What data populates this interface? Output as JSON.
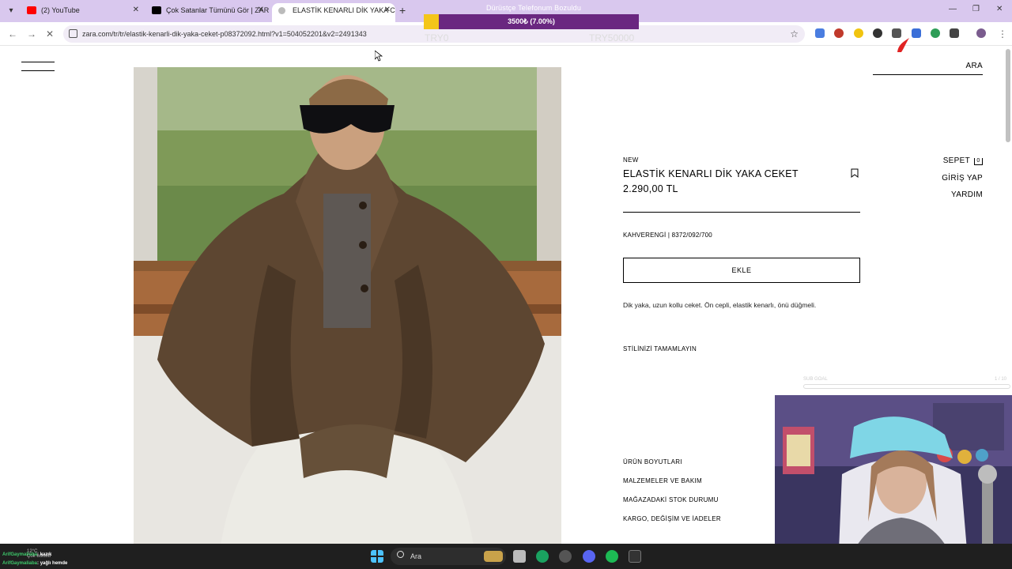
{
  "browser": {
    "tabs": [
      {
        "label": "(2) YouTube",
        "favicon_color": "#ff0000",
        "active": false
      },
      {
        "label": "Çok Satanlar Tümünü Gör | ZAR",
        "favicon_color": "#000000",
        "active": false
      },
      {
        "label": "ELASTİK KENARLI DİK YAKA CEK",
        "favicon_color": "#888888",
        "active": true
      }
    ],
    "new_tab_glyph": "+",
    "url": "zara.com/tr/tr/elastik-kenarli-dik-yaka-ceket-p08372092.html?v1=504052201&v2=2491343"
  },
  "donation_overlay": {
    "title": "Dürüstçe Telefonum Bozuldu",
    "progress_text": "3500₺ (7.00%)",
    "progress_fraction": 0.07,
    "min_label": "TRY0",
    "max_label": "TRY50000"
  },
  "zara": {
    "header": {
      "search_label": "ARA",
      "cart_label": "SEPET",
      "cart_count": "0",
      "login_label": "GİRİŞ YAP",
      "help_label": "YARDIM"
    },
    "product": {
      "badge": "NEW",
      "title": "ELASTİK KENARLI DİK YAKA CEKET",
      "price": "2.290,00 TL",
      "color_ref": "KAHVERENGİ | 8372/092/700",
      "add_button": "EKLE",
      "description": "Dik yaka, uzun kollu ceket. Ön cepli, elastik kenarlı, önü düğmeli.",
      "style_heading": "STİLİNİZİ TAMAMLAYIN",
      "links": [
        "ÜRÜN BOYUTLARI",
        "MALZEMELER VE BAKIM",
        "MAĞAZADAKİ STOK DURUMU",
        "KARGO, DEĞİŞİM VE İADELER"
      ]
    }
  },
  "stream_overlay": {
    "goal_label": "SUB GOAL",
    "goal_count": "1 / 10",
    "chat": [
      {
        "user": "ArifGaymaliaba",
        "message": ": kazık"
      },
      {
        "user": "ArifGaymaliaba",
        "message": ": yağlı hemde"
      }
    ],
    "weather": {
      "temp": "12°C",
      "condition": "Çok bulutlu"
    }
  },
  "taskbar": {
    "search_placeholder": "Ara"
  }
}
